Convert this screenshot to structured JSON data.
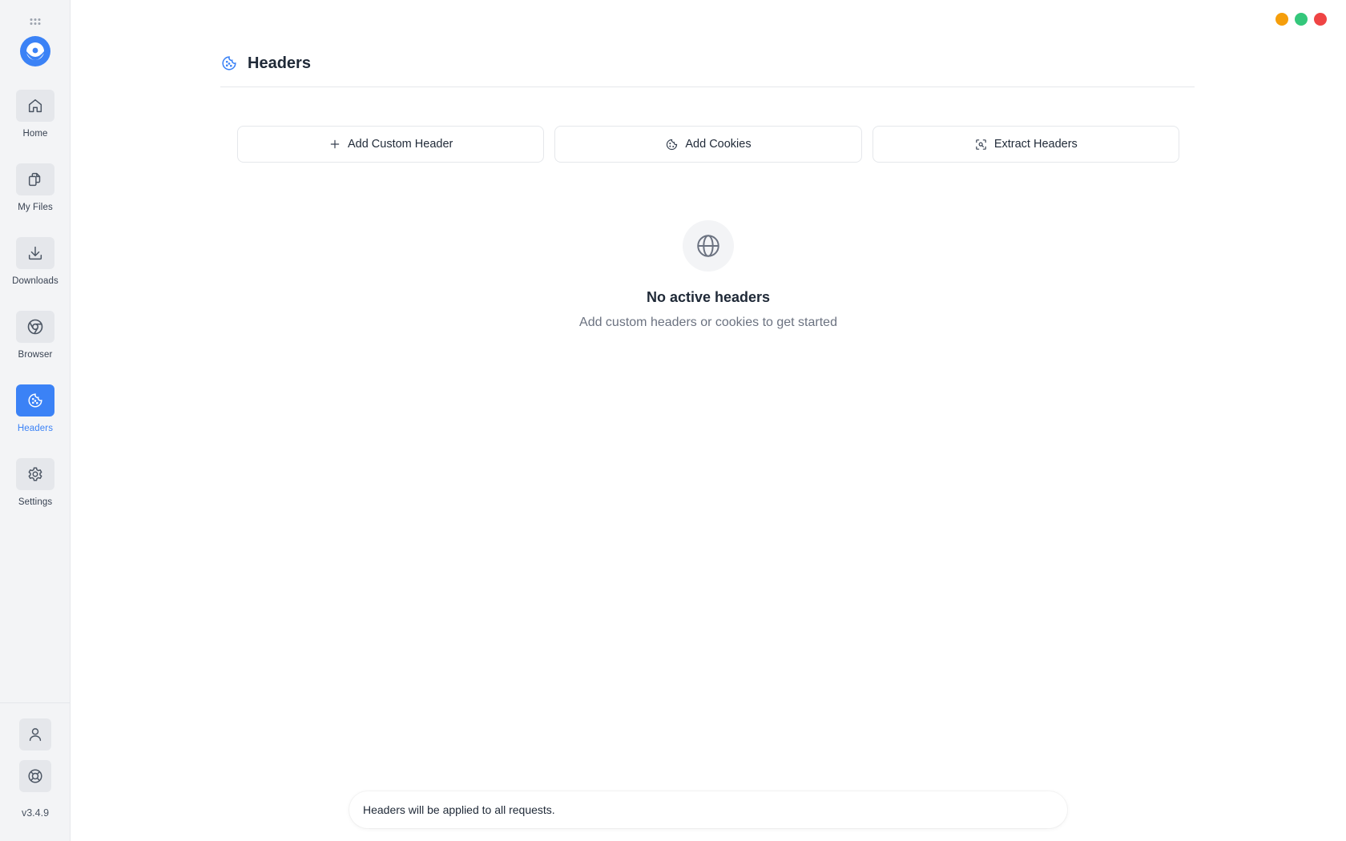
{
  "sidebar": {
    "items": [
      {
        "label": "Home",
        "icon": "home-icon",
        "active": false
      },
      {
        "label": "My Files",
        "icon": "files-icon",
        "active": false
      },
      {
        "label": "Downloads",
        "icon": "download-icon",
        "active": false
      },
      {
        "label": "Browser",
        "icon": "browser-icon",
        "active": false
      },
      {
        "label": "Headers",
        "icon": "cookie-icon",
        "active": true
      },
      {
        "label": "Settings",
        "icon": "gear-icon",
        "active": false
      }
    ],
    "bottom_icons": [
      "user-icon",
      "lifebuoy-icon"
    ],
    "version": "v3.4.9"
  },
  "window_controls": {
    "colors": [
      "#f59e0b",
      "#34c77b",
      "#ef4444"
    ]
  },
  "header": {
    "title": "Headers",
    "icon": "cookie-icon"
  },
  "actions": [
    {
      "label": "Add Custom Header",
      "icon": "plus-icon"
    },
    {
      "label": "Add Cookies",
      "icon": "cookie-icon"
    },
    {
      "label": "Extract Headers",
      "icon": "scan-icon"
    }
  ],
  "empty_state": {
    "icon": "globe-icon",
    "title": "No active headers",
    "subtitle": "Add custom headers or cookies to get started"
  },
  "footer": {
    "note": "Headers will be applied to all requests."
  },
  "colors": {
    "accent": "#3b82f6",
    "sidebar_bg": "#f3f4f6"
  }
}
